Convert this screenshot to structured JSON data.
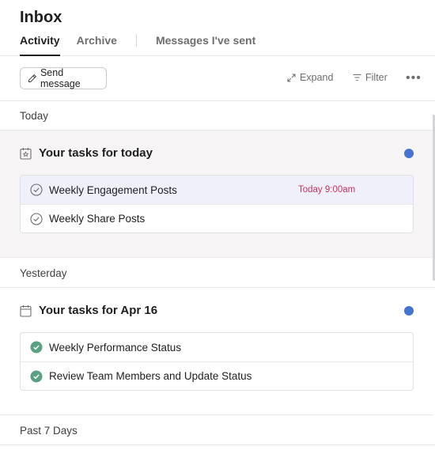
{
  "header": {
    "title": "Inbox",
    "tabs": [
      {
        "label": "Activity",
        "active": true
      },
      {
        "label": "Archive",
        "active": false
      },
      {
        "label": "Messages I've sent",
        "active": false
      }
    ]
  },
  "toolbar": {
    "send_label": "Send message",
    "expand_label": "Expand",
    "filter_label": "Filter",
    "more_label": "•••"
  },
  "groups": {
    "today": "Today",
    "yesterday": "Yesterday",
    "past7": "Past 7 Days"
  },
  "sections": {
    "today": {
      "title": "Your tasks for today",
      "unread": true,
      "tasks": [
        {
          "name": "Weekly Engagement Posts",
          "due": "Today 9:00am",
          "completed": false
        },
        {
          "name": "Weekly Share Posts",
          "completed": false
        }
      ]
    },
    "yesterday": {
      "title": "Your tasks for Apr 16",
      "unread": true,
      "tasks": [
        {
          "name": "Weekly Performance Status",
          "completed": true
        },
        {
          "name": "Review Team Members and Update Status",
          "completed": true
        }
      ]
    }
  },
  "colors": {
    "unread_dot": "#4573d2",
    "due_today": "#c9325c",
    "completed_check": "#58a182"
  }
}
